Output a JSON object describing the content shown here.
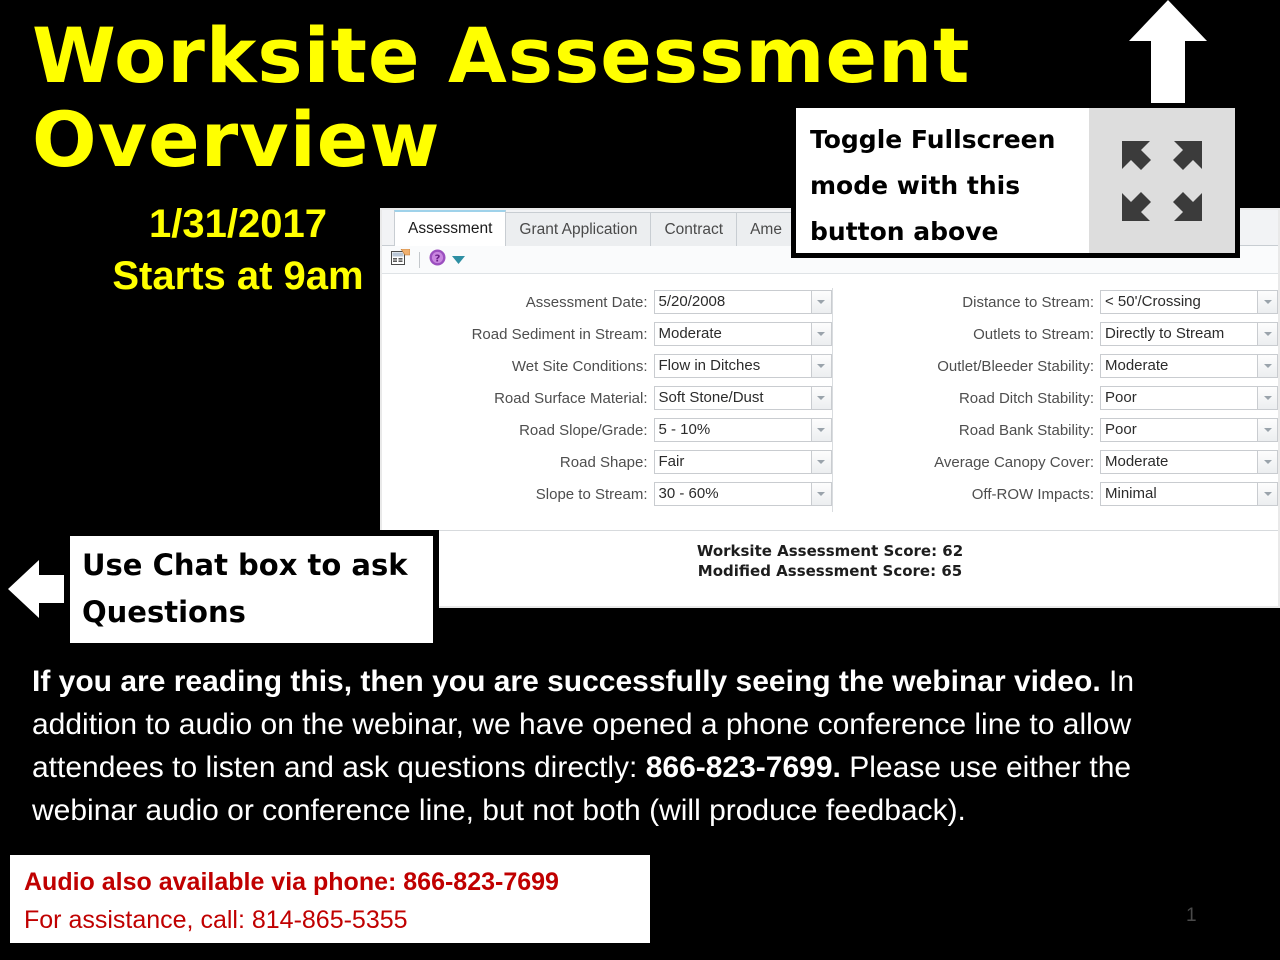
{
  "slide": {
    "background_color": "#000000",
    "accent_color": "#FFFF00",
    "red_color": "#C00000",
    "page_number": "1"
  },
  "title": {
    "line1": "Worksite Assessment",
    "line2": "Overview",
    "date": "1/31/2017",
    "start_time": "Starts at 9am"
  },
  "fullscreen_callout": {
    "line1": "Toggle Fullscreen",
    "line2": "mode with this",
    "line3": "button above",
    "icon": "fullscreen-expand-icon"
  },
  "chat_callout": {
    "line1": "Use Chat box to ask",
    "line2": "Questions",
    "arrow_icon": "arrow-left-icon"
  },
  "up_arrow": {
    "icon": "arrow-up-icon"
  },
  "app": {
    "tabs": [
      {
        "label": "Assessment",
        "active": true
      },
      {
        "label": "Grant Application",
        "active": false
      },
      {
        "label": "Contract",
        "active": false
      },
      {
        "label": "Ame",
        "active": false
      }
    ],
    "toolbar": {
      "report_icon": "report-form-icon",
      "help_icon": "help-question-icon",
      "help_dropdown_icon": "chevron-down-icon"
    },
    "left_fields": [
      {
        "label": "Assessment Date:",
        "value": "5/20/2008"
      },
      {
        "label": "Road Sediment in Stream:",
        "value": "Moderate"
      },
      {
        "label": "Wet Site Conditions:",
        "value": "Flow in Ditches"
      },
      {
        "label": "Road Surface Material:",
        "value": "Soft Stone/Dust"
      },
      {
        "label": "Road Slope/Grade:",
        "value": "5 - 10%"
      },
      {
        "label": "Road Shape:",
        "value": "Fair"
      },
      {
        "label": "Slope to Stream:",
        "value": "30 - 60%"
      }
    ],
    "right_fields": [
      {
        "label": "Distance to Stream:",
        "value": "< 50'/Crossing"
      },
      {
        "label": "Outlets to Stream:",
        "value": "Directly to Stream"
      },
      {
        "label": "Outlet/Bleeder Stability:",
        "value": "Moderate"
      },
      {
        "label": "Road Ditch Stability:",
        "value": "Poor"
      },
      {
        "label": "Road Bank Stability:",
        "value": "Poor"
      },
      {
        "label": "Average Canopy Cover:",
        "value": "Moderate"
      },
      {
        "label": "Off-ROW Impacts:",
        "value": "Minimal"
      }
    ],
    "scores": {
      "worksite": "Worksite Assessment Score: 62",
      "modified": "Modified Assessment Score: 65"
    }
  },
  "body": {
    "bold_lead": "If you are reading this, then you are successfully seeing the webinar video.",
    "rest_part1": " In addition to audio on the webinar, we have opened a phone conference line to allow attendees to listen and ask questions directly: ",
    "phone_bold": "866-823-7699.",
    "rest_part2": "  Please use either the webinar audio or conference line, but not both (will produce feedback)."
  },
  "audio_box": {
    "line1": "Audio also available via phone: 866-823-7699",
    "line2": "For assistance, call: 814-865-5355"
  }
}
